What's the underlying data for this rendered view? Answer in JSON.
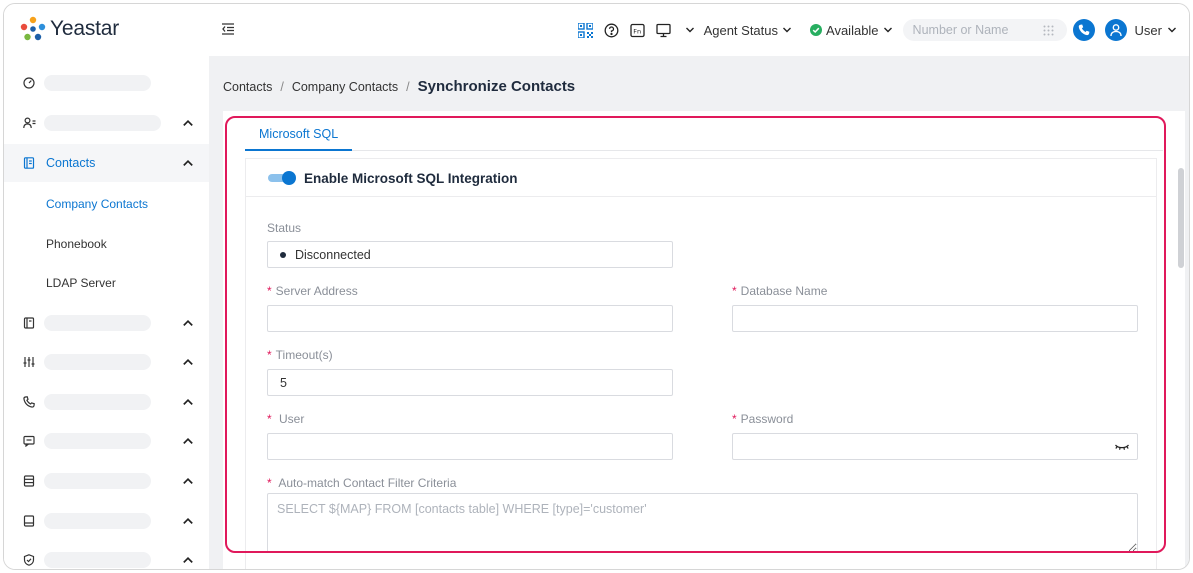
{
  "header": {
    "logo_text": "Yeastar",
    "agent_status_label": "Agent Status",
    "availability_label": "Available",
    "search_placeholder": "Number or Name",
    "user_label": "User"
  },
  "sidebar": {
    "contacts_label": "Contacts",
    "sub_items": [
      "Company Contacts",
      "Phonebook",
      "LDAP Server"
    ]
  },
  "breadcrumb": {
    "items": [
      "Contacts",
      "Company Contacts"
    ],
    "current": "Synchronize Contacts"
  },
  "tabs": [
    "Microsoft SQL"
  ],
  "integration": {
    "title": "Enable Microsoft SQL Integration",
    "enabled": true
  },
  "form": {
    "status_label": "Status",
    "status_value": "Disconnected",
    "server_address_label": "Server Address",
    "server_address_value": "",
    "database_name_label": "Database Name",
    "database_name_value": "",
    "timeout_label": "Timeout(s)",
    "timeout_value": "5",
    "user_label": "User",
    "user_value": "",
    "password_label": "Password",
    "password_value": "",
    "filter_label": "Auto-match Contact Filter Criteria",
    "filter_placeholder": "SELECT ${MAP} FROM [contacts table] WHERE [type]='customer'"
  },
  "colors": {
    "accent": "#0b76d1",
    "highlight": "#e0195b",
    "available": "#27ae60"
  }
}
